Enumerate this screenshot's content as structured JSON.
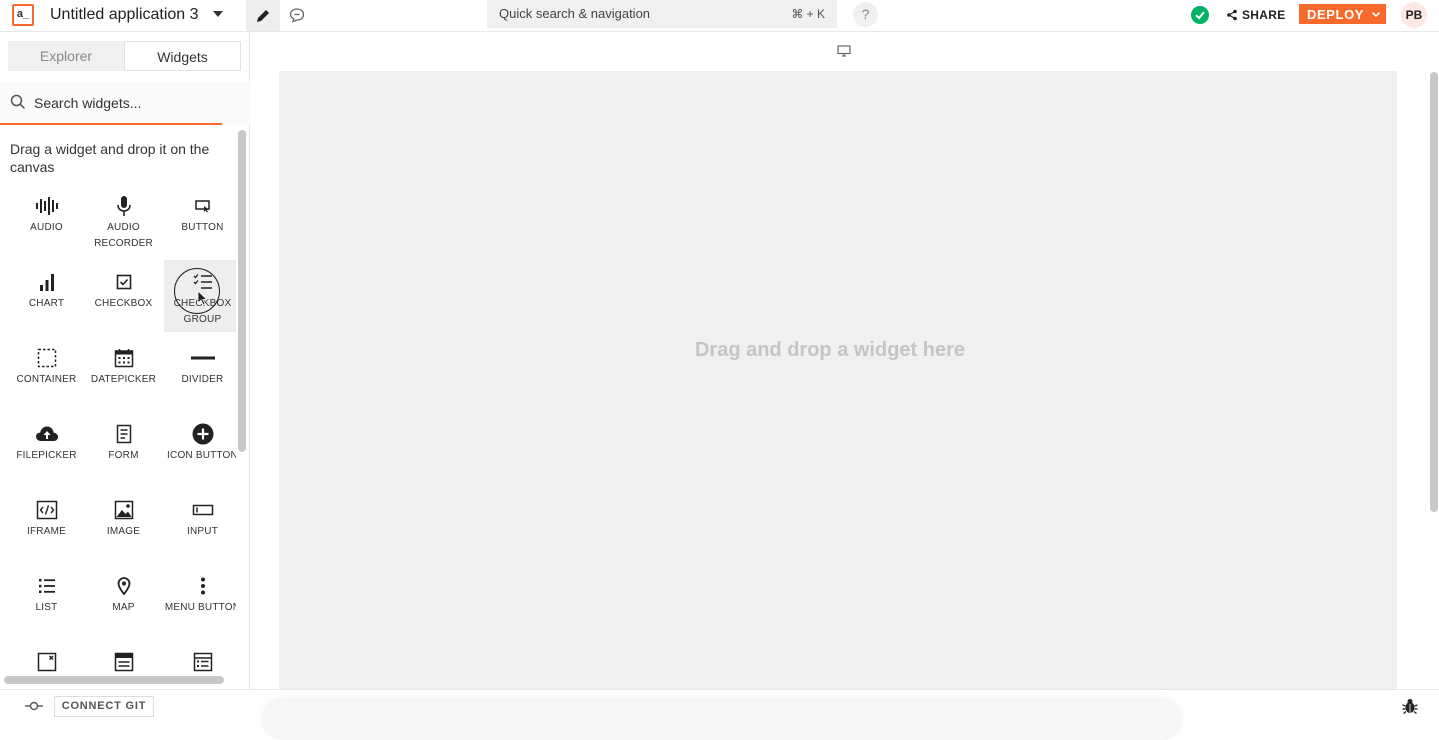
{
  "header": {
    "logo_text": "a_",
    "app_title": "Untitled application 3",
    "search": {
      "label": "Quick search & navigation",
      "shortcut": "⌘ + K"
    },
    "help": "?",
    "share_label": "SHARE",
    "deploy_label": "DEPLOY",
    "avatar_initials": "PB",
    "colors": {
      "accent": "#f86a2b",
      "success": "#03b365"
    }
  },
  "sidebar": {
    "tabs": {
      "explorer": "Explorer",
      "widgets": "Widgets"
    },
    "search_placeholder": "Search widgets...",
    "hint": "Drag a widget and drop it on the canvas",
    "widgets": [
      {
        "label": "AUDIO",
        "icon": "audio-icon"
      },
      {
        "label": "AUDIO RECORDER",
        "icon": "microphone-icon"
      },
      {
        "label": "BUTTON",
        "icon": "button-icon"
      },
      {
        "label": "CHART",
        "icon": "chart-icon"
      },
      {
        "label": "CHECKBOX",
        "icon": "checkbox-icon"
      },
      {
        "label": "CHECKBOX GROUP",
        "icon": "checkbox-group-icon"
      },
      {
        "label": "CONTAINER",
        "icon": "container-icon"
      },
      {
        "label": "DATEPICKER",
        "icon": "calendar-icon"
      },
      {
        "label": "DIVIDER",
        "icon": "divider-icon"
      },
      {
        "label": "FILEPICKER",
        "icon": "upload-cloud-icon"
      },
      {
        "label": "FORM",
        "icon": "form-icon"
      },
      {
        "label": "ICON BUTTON",
        "icon": "plus-circle-icon"
      },
      {
        "label": "IFRAME",
        "icon": "iframe-icon"
      },
      {
        "label": "IMAGE",
        "icon": "image-icon"
      },
      {
        "label": "INPUT",
        "icon": "input-icon"
      },
      {
        "label": "LIST",
        "icon": "list-icon"
      },
      {
        "label": "MAP",
        "icon": "map-pin-icon"
      },
      {
        "label": "MENU BUTTON",
        "icon": "menu-dots-icon"
      }
    ]
  },
  "canvas": {
    "drop_hint": "Drag and drop a widget here"
  },
  "bottom": {
    "connect_git": "CONNECT GIT"
  }
}
